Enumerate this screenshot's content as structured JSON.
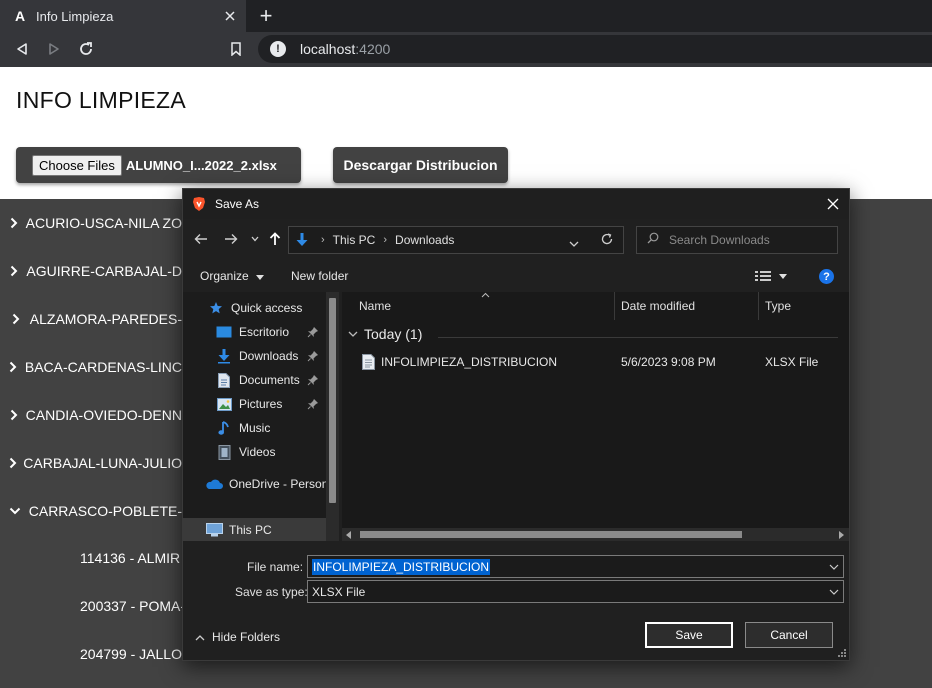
{
  "browser": {
    "tab_title": "Info Limpieza",
    "tab_favicon": "A",
    "new_tab": "+",
    "url_host": "localhost",
    "url_port": ":4200"
  },
  "page": {
    "title": "INFO LIMPIEZA",
    "choose_files_label": "Choose Files",
    "file_name": "ALUMNO_I...2022_2.xlsx",
    "download_button": "Descargar Distribucion",
    "list_items": [
      {
        "label": "ACURIO-USCA-NILA ZO",
        "expanded": false
      },
      {
        "label": "AGUIRRE-CARBAJAL-D",
        "expanded": false
      },
      {
        "label": "ALZAMORA-PAREDES-",
        "expanded": false
      },
      {
        "label": "BACA-CARDENAS-LINC",
        "expanded": false
      },
      {
        "label": "CANDIA-OVIEDO-DENN",
        "expanded": false
      },
      {
        "label": "CARBAJAL-LUNA-JULIO",
        "expanded": false
      },
      {
        "label": "CARRASCO-POBLETE-",
        "expanded": true
      }
    ],
    "sub_items": [
      "114136 - ALMIR",
      "200337 - POMA-",
      "204799 - JALLO-"
    ]
  },
  "dialog": {
    "title": "Save As",
    "breadcrumb": [
      "This PC",
      "Downloads"
    ],
    "search_placeholder": "Search Downloads",
    "organize_label": "Organize",
    "new_folder_label": "New folder",
    "help_label": "?",
    "nav_items": [
      {
        "label": "Quick access",
        "icon": "star-icon"
      },
      {
        "label": "Escritorio",
        "icon": "desktop-folder-icon",
        "pinned": true
      },
      {
        "label": "Downloads",
        "icon": "downloads-folder-icon",
        "pinned": true
      },
      {
        "label": "Documents",
        "icon": "documents-folder-icon",
        "pinned": true
      },
      {
        "label": "Pictures",
        "icon": "pictures-folder-icon",
        "pinned": true
      },
      {
        "label": "Music",
        "icon": "music-folder-icon"
      },
      {
        "label": "Videos",
        "icon": "videos-folder-icon"
      },
      {
        "label": "OneDrive - Person",
        "icon": "onedrive-icon"
      },
      {
        "label": "This PC",
        "icon": "computer-icon",
        "selected": true
      }
    ],
    "columns": {
      "name": "Name",
      "date": "Date modified",
      "type": "Type"
    },
    "group_label": "Today (1)",
    "files": [
      {
        "name": "INFOLIMPIEZA_DISTRIBUCION",
        "date": "5/6/2023 9:08 PM",
        "type": "XLSX File"
      }
    ],
    "file_name_label": "File name:",
    "file_name_value": "INFOLIMPIEZA_DISTRIBUCION",
    "save_type_label": "Save as type:",
    "save_type_value": "XLSX File",
    "hide_folders_label": "Hide Folders",
    "save_button": "Save",
    "cancel_button": "Cancel"
  }
}
